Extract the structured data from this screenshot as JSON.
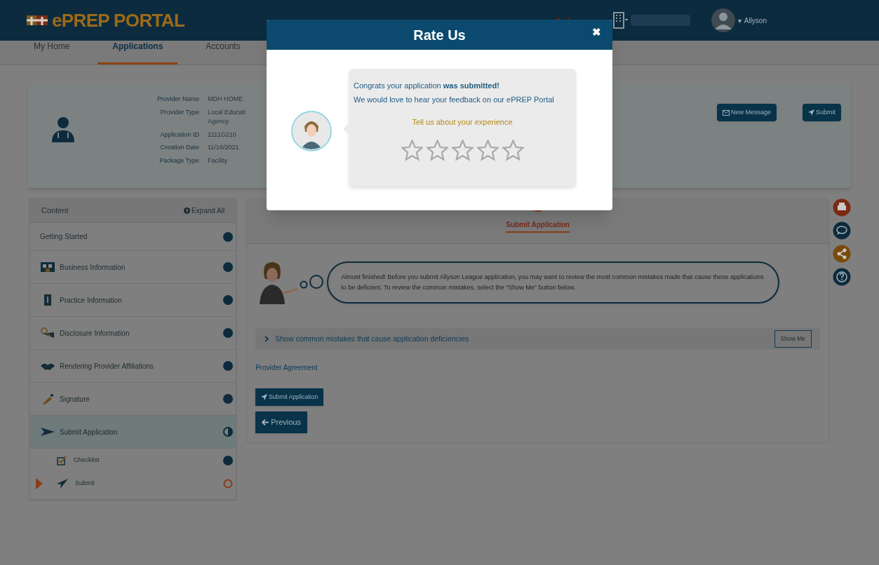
{
  "header": {
    "logo_text": "ePREP PORTAL",
    "user_caret": "▾",
    "user_name": "Allyson"
  },
  "nav": [
    {
      "label": "My Home",
      "selected": false
    },
    {
      "label": "Applications",
      "selected": true
    },
    {
      "label": "Accounts",
      "selected": false
    }
  ],
  "provider": {
    "fields": [
      {
        "label": "Provider Name",
        "value_lines": [
          "MDH HOME"
        ]
      },
      {
        "label": "Provider Type",
        "value_lines": [
          "Local Educati",
          "Agency"
        ]
      },
      {
        "label": "Application ID",
        "value_lines": [
          "2111G210"
        ]
      },
      {
        "label": "Creation Date",
        "value_lines": [
          "11/16/2021"
        ]
      },
      {
        "label": "Package Type",
        "value_lines": [
          "Facility"
        ]
      }
    ],
    "buttons": [
      {
        "label": "New Message",
        "kind": "message"
      },
      {
        "label": "Submit",
        "kind": "send"
      }
    ]
  },
  "sidebar": {
    "title": "Content",
    "expand_label": "Expand All",
    "items": [
      {
        "label": "Getting Started",
        "level": 1,
        "selected": false
      },
      {
        "label": "Business Information",
        "level": 1,
        "selected": false
      },
      {
        "label": "Practice Information",
        "level": 1,
        "selected": false
      },
      {
        "label": "Disclosure Information",
        "level": 1,
        "selected": false
      },
      {
        "label": "Rendering Provider Affiliations",
        "level": 1,
        "selected": false
      },
      {
        "label": "Signature",
        "level": 1,
        "selected": false
      },
      {
        "label": "Submit Application",
        "level": 0.5,
        "selected": true,
        "children": [
          {
            "label": "Checklist",
            "level": 1,
            "current": false
          },
          {
            "label": "Submit",
            "level": 0,
            "current": true
          }
        ]
      }
    ]
  },
  "main": {
    "step_title": "Submit Application",
    "tip": "Almost finished! Before you submit Allyson League application, you may want to review the most common mistakes made that cause these applications to be deficient. To review the common mistakes, select the \"Show Me\" button below.",
    "accordion": {
      "label": "Show common mistakes that cause application deficiencies",
      "expanded": false,
      "button": "Show Me"
    },
    "link": "Provider Agreement",
    "submit_button": "Submit Application",
    "previous_button": "Previous"
  },
  "modal": {
    "title": "Rate Us",
    "close": "✖",
    "message_lines": [
      "Congrats your application **was submitted!**",
      "We would love to hear your feedback on our ePREP Portal"
    ],
    "prompt": "Tell us about your experience",
    "stars": 0
  }
}
